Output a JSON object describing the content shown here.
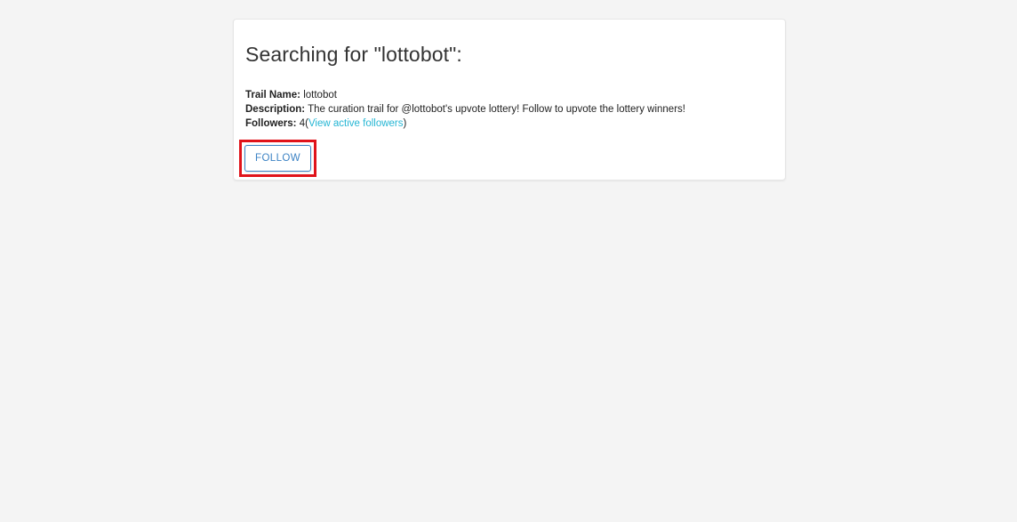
{
  "search": {
    "heading": "Searching for \"lottobot\":"
  },
  "trail": {
    "name_label": "Trail Name:",
    "name_value": "lottobot",
    "description_label": "Description:",
    "description_value": "The curation trail for @lottobot's upvote lottery! Follow to upvote the lottery winners!",
    "followers_label": "Followers:",
    "followers_count": "4",
    "followers_paren_open": "(",
    "followers_link": "View active followers",
    "followers_paren_close": ")"
  },
  "actions": {
    "follow_label": "FOLLOW"
  },
  "colors": {
    "link": "#26b6d4",
    "button_accent": "#3b82c4",
    "highlight_box": "#e0131a"
  }
}
